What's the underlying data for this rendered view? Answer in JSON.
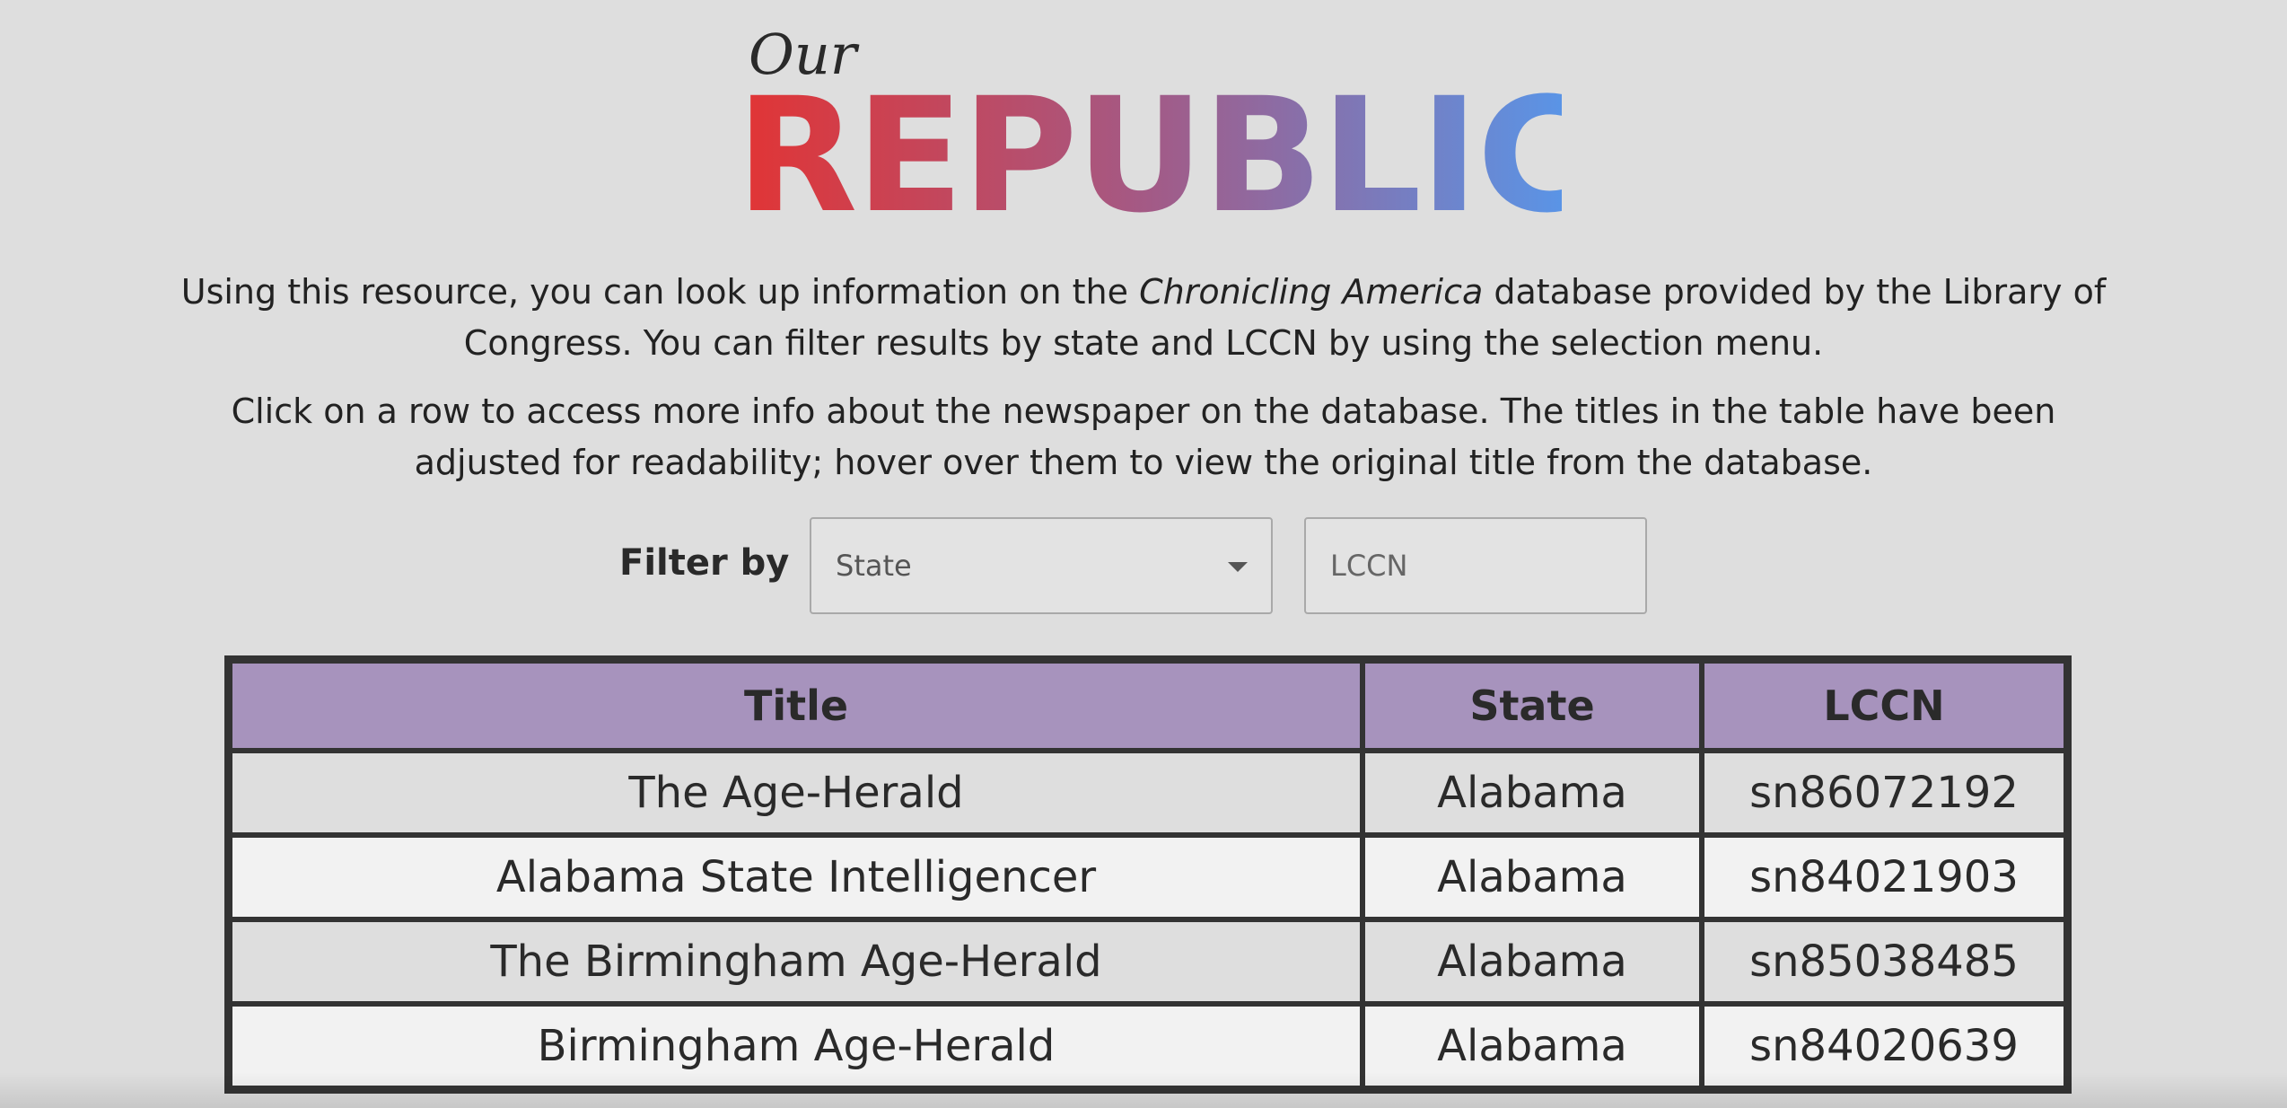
{
  "logo": {
    "small": "Our",
    "large": "REPUBLIC",
    "gradient_colors": [
      "#e23434",
      "#a35a86",
      "#5a94e6"
    ]
  },
  "intro": {
    "p1_before": "Using this resource, you can look up information on the ",
    "p1_italic": "Chronicling America",
    "p1_after": " database provided by the Library of Congress. You can filter results by state and LCCN by using the selection menu.",
    "p2": "Click on a row to access more info about the newspaper on the database. The titles in the table have been adjusted for readability; hover over them to view the original title from the database."
  },
  "filter": {
    "label": "Filter by",
    "state_select": "State",
    "lccn_placeholder": "LCCN"
  },
  "table": {
    "header_color": "#a793bd",
    "headers": {
      "title": "Title",
      "state": "State",
      "lccn": "LCCN"
    },
    "rows": [
      {
        "title": "The Age-Herald",
        "state": "Alabama",
        "lccn": "sn86072192"
      },
      {
        "title": "Alabama State Intelligencer",
        "state": "Alabama",
        "lccn": "sn84021903"
      },
      {
        "title": "The Birmingham Age-Herald",
        "state": "Alabama",
        "lccn": "sn85038485"
      },
      {
        "title": "Birmingham Age-Herald",
        "state": "Alabama",
        "lccn": "sn84020639"
      }
    ]
  }
}
